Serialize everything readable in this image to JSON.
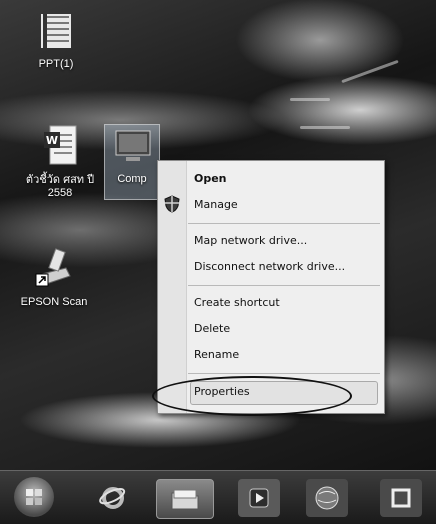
{
  "desktop": {
    "icons": [
      {
        "name": "ppt-folder",
        "label": "PPT(1)"
      },
      {
        "name": "thai-document",
        "label": "ตัวชี้วัด ศสท ปี 2558"
      },
      {
        "name": "computer",
        "label": "Comp"
      },
      {
        "name": "epson-scan",
        "label": "EPSON Scan"
      }
    ]
  },
  "context_menu": {
    "items": [
      {
        "label": "Open",
        "bold": true
      },
      {
        "label": "Manage",
        "icon": "shield-icon"
      },
      {
        "label": "Map network drive..."
      },
      {
        "label": "Disconnect network drive..."
      },
      {
        "label": "Create shortcut"
      },
      {
        "label": "Delete"
      },
      {
        "label": "Rename"
      },
      {
        "label": "Properties",
        "highlighted": true,
        "circled": true
      }
    ]
  },
  "taskbar": {
    "buttons": [
      "start-orb-icon",
      "internet-explorer-icon",
      "file-explorer-icon",
      "media-player-icon",
      "browser-globe-icon",
      "window-icon"
    ]
  },
  "colors": {
    "menu_bg": "#efefef",
    "circle_annotation": "#111111"
  }
}
